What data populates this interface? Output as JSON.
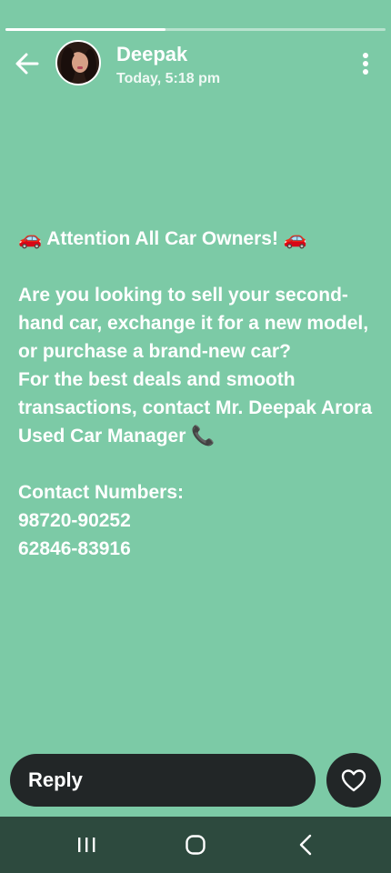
{
  "story": {
    "progress": 0.42
  },
  "header": {
    "back_icon": "arrow-left-icon",
    "sender_name": "Deepak",
    "timestamp": "Today, 5:18 pm",
    "more_icon": "more-vertical-icon"
  },
  "message": {
    "text": "🚗 Attention All Car Owners! 🚗\n\nAre you looking to sell your second-hand car, exchange it for a new model, or purchase a brand-new car?\nFor the best deals and smooth transactions, contact Mr. Deepak Arora\nUsed Car Manager 📞\n\nContact Numbers:\n98720-90252\n62846-83916"
  },
  "reply": {
    "label": "Reply",
    "like_icon": "heart-icon"
  },
  "system_nav": {
    "recents_icon": "recents-icon",
    "home_icon": "home-icon",
    "back_icon": "back-chevron-icon"
  },
  "colors": {
    "background": "#7ccaa6",
    "reply_bar": "#222627",
    "nav_bar": "#2d4a3e"
  }
}
